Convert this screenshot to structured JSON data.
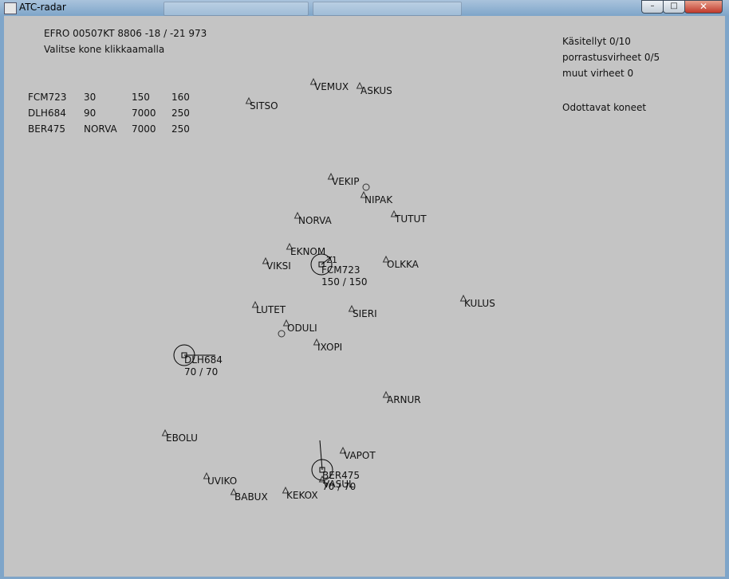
{
  "window": {
    "title": "ATC-radar",
    "minimize": "–",
    "maximize": "□",
    "close": "✕"
  },
  "header": {
    "status": "EFRO 00507KT 8806 -18 / -21 973",
    "instruction": "Valitse kone klikkaamalla"
  },
  "flight_table": [
    [
      "FCM723",
      "30",
      "150",
      "160"
    ],
    [
      "DLH684",
      "90",
      "7000",
      "250"
    ],
    [
      "BER475",
      "NORVA",
      "7000",
      "250"
    ]
  ],
  "stats": {
    "handled": "Käsitellyt 0/10",
    "separation_errors": "porrastusvirheet 0/5",
    "other_errors": "muut virheet 0",
    "waiting": "Odottavat koneet"
  },
  "waypoints": [
    "VEMUX",
    "ASKUS",
    "SITSO",
    "VEKIP",
    "NIPAK",
    "NORVA",
    "TUTUT",
    "EKNOM",
    "VIKSI",
    "OLKKA",
    "KULUS",
    "LUTET",
    "SIERI",
    "ODULI",
    "IXOPI",
    "ARNUR",
    "EBOLU",
    "VAPOT",
    "UVIKO",
    "BABUX",
    "KEKOX",
    "VASUL"
  ],
  "aircraft": [
    {
      "callsign": "FCM723",
      "info": "150 / 150"
    },
    {
      "callsign": "DLH684",
      "info": "70 / 70"
    },
    {
      "callsign": "BER475",
      "info": "70 / 70"
    }
  ],
  "runway_label": "21"
}
